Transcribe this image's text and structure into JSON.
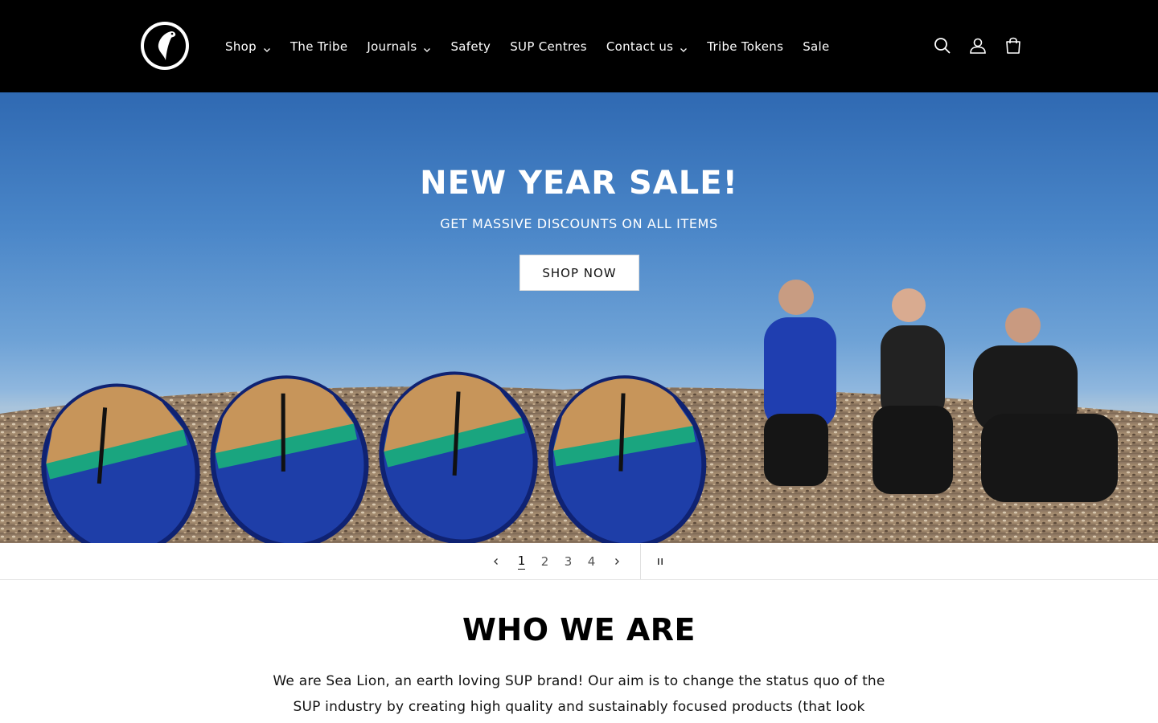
{
  "header": {
    "nav": [
      {
        "label": "Shop",
        "has_dropdown": true
      },
      {
        "label": "The Tribe",
        "has_dropdown": false
      },
      {
        "label": "Journals",
        "has_dropdown": true
      },
      {
        "label": "Safety",
        "has_dropdown": false
      },
      {
        "label": "SUP Centres",
        "has_dropdown": false
      },
      {
        "label": "Contact us",
        "has_dropdown": true
      },
      {
        "label": "Tribe Tokens",
        "has_dropdown": false
      },
      {
        "label": "Sale",
        "has_dropdown": false
      }
    ],
    "icons": [
      "search-icon",
      "account-icon",
      "cart-icon"
    ]
  },
  "hero": {
    "title": "NEW YEAR SALE!",
    "subtitle": "GET MASSIVE DISCOUNTS ON ALL ITEMS",
    "button_label": "SHOP NOW"
  },
  "slider": {
    "pages": [
      "1",
      "2",
      "3",
      "4"
    ],
    "current": "1"
  },
  "who": {
    "title": "WHO WE ARE",
    "line1": "We are Sea Lion, an earth loving SUP brand! Our aim is to change the status quo of the",
    "line2": "SUP industry by creating high quality and sustainably focused products (that look"
  },
  "colors": {
    "header_bg": "#000000",
    "sky": "#4a86c8",
    "text": "#121212"
  }
}
